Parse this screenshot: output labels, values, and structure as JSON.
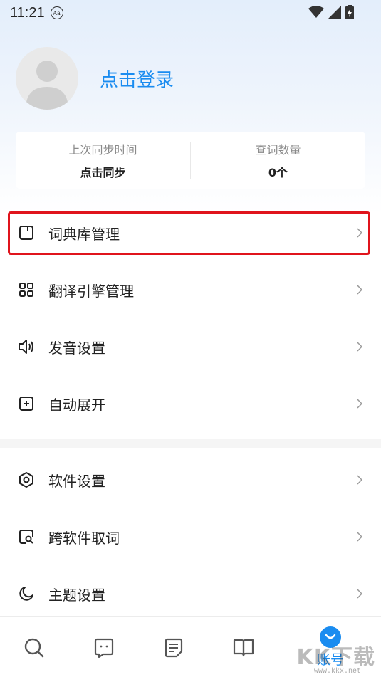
{
  "status_bar": {
    "time": "11:21",
    "aa_label": "Aa"
  },
  "profile": {
    "login_label": "点击登录"
  },
  "stats": {
    "sync_label": "上次同步时间",
    "sync_value": "点击同步",
    "count_label": "查词数量",
    "count_value": "0个"
  },
  "menu_group_1": [
    {
      "label": "词典库管理",
      "icon": "book-icon"
    },
    {
      "label": "翻译引擎管理",
      "icon": "grid-icon"
    },
    {
      "label": "发音设置",
      "icon": "speaker-icon"
    },
    {
      "label": "自动展开",
      "icon": "plus-square-icon"
    }
  ],
  "menu_group_2": [
    {
      "label": "软件设置",
      "icon": "settings-hex-icon"
    },
    {
      "label": "跨软件取词",
      "icon": "search-doc-icon"
    },
    {
      "label": "主题设置",
      "icon": "moon-icon"
    }
  ],
  "bottom_nav": {
    "items": [
      "search-icon",
      "chat-icon",
      "note-icon",
      "book-open-icon",
      "account-icon"
    ],
    "active_label": "账号"
  },
  "watermark": {
    "text": "KK下载",
    "url": "www.kkx.net"
  },
  "colors": {
    "accent": "#1a8cf0",
    "highlight": "#e0141c"
  }
}
